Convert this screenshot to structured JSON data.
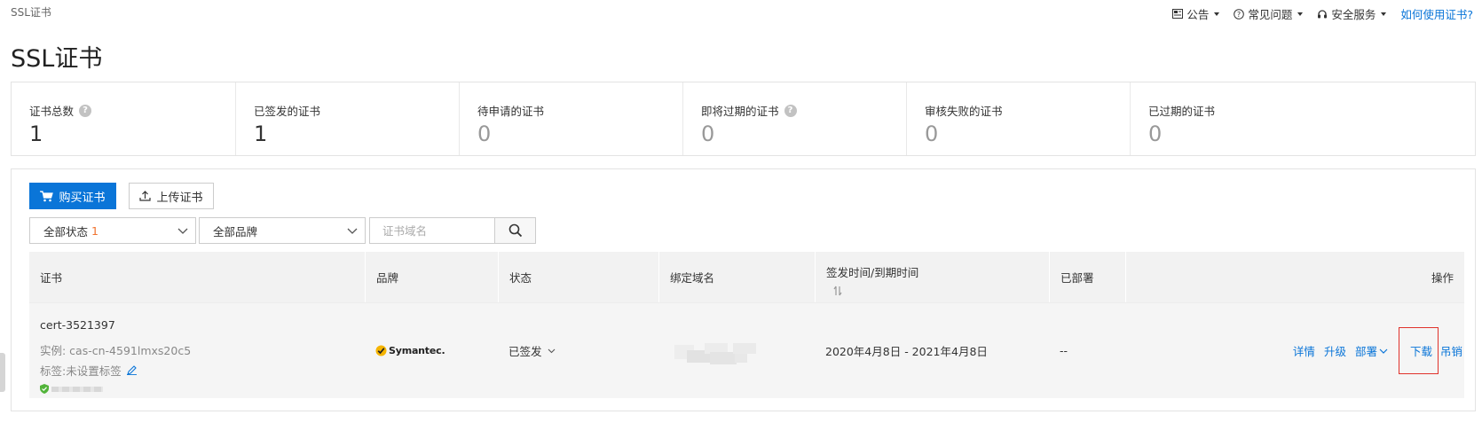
{
  "breadcrumb": "SSL证书",
  "header": {
    "announcement": "公告",
    "faq": "常见问题",
    "security": "安全服务",
    "help_link": "如何使用证书?"
  },
  "page_title": "SSL证书",
  "stats": [
    {
      "label": "证书总数",
      "value": "1",
      "has_help": true
    },
    {
      "label": "已签发的证书",
      "value": "1",
      "has_help": false
    },
    {
      "label": "待申请的证书",
      "value": "0",
      "has_help": false
    },
    {
      "label": "即将过期的证书",
      "value": "0",
      "has_help": true
    },
    {
      "label": "审核失败的证书",
      "value": "0",
      "has_help": false
    },
    {
      "label": "已过期的证书",
      "value": "0",
      "has_help": false
    }
  ],
  "toolbar": {
    "buy_label": "购买证书",
    "upload_label": "上传证书"
  },
  "filters": {
    "status_label": "全部状态",
    "status_count": "1",
    "brand_label": "全部品牌",
    "search_placeholder": "证书域名"
  },
  "table": {
    "columns": {
      "cert": "证书",
      "brand": "品牌",
      "status": "状态",
      "domain": "绑定域名",
      "dates": "签发时间/到期时间",
      "deployed": "已部署",
      "actions": "操作"
    },
    "rows": [
      {
        "name": "cert-3521397",
        "instance": "实例: cas-cn-4591lmxs20c5",
        "tag": "标签:未设置标签",
        "brand": "Symantec.",
        "status": "已签发",
        "dates": "2020年4月8日 - 2021年4月8日",
        "deployed": "--",
        "actions": {
          "details": "详情",
          "upgrade": "升级",
          "deploy": "部署",
          "download": "下载",
          "revoke": "吊销"
        }
      }
    ]
  },
  "colors": {
    "primary": "#0a75d8",
    "highlight_box": "#e0322b",
    "status_count": "#f0732f",
    "shield": "#52b43a",
    "symantec_check": "#f5b400"
  }
}
